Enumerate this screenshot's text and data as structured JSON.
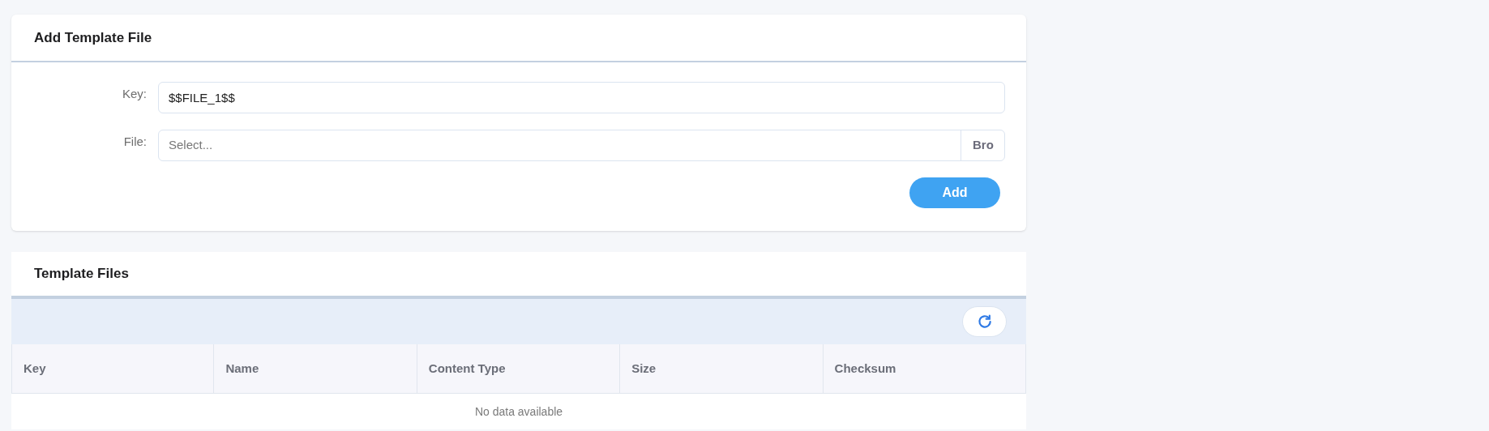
{
  "add_card": {
    "title": "Add Template File",
    "fields": [
      {
        "label": "Key:",
        "value": "$$FILE_1$$",
        "kind": "text"
      },
      {
        "label": "File:",
        "placeholder": "Select...",
        "kind": "file",
        "button": "Bro"
      }
    ],
    "button": "Add"
  },
  "files_card": {
    "title": "Template Files",
    "table": {
      "columns": [
        "Key",
        "Name",
        "Content Type",
        "Size",
        "Checksum"
      ],
      "empty_text": "No data available"
    }
  }
}
